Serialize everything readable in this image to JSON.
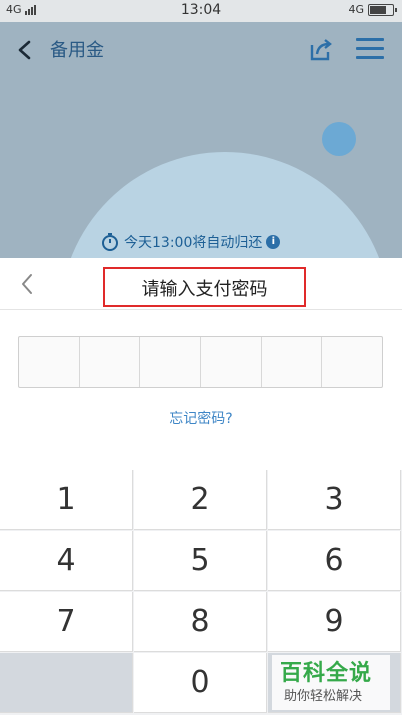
{
  "status_bar": {
    "network_left": "4G",
    "time": "13:04",
    "network_right": "4G",
    "battery_level": 0.75
  },
  "header": {
    "title": "备用金"
  },
  "notice": {
    "auto_return": "今天13:00将自动归还",
    "info": "i"
  },
  "password_sheet": {
    "title": "请输入支付密码",
    "digits": 6,
    "forgot_link": "忘记密码?"
  },
  "keypad": {
    "keys": [
      "1",
      "2",
      "3",
      "4",
      "5",
      "6",
      "7",
      "8",
      "9",
      "",
      "0",
      ""
    ]
  },
  "watermark": {
    "main": "百科全说",
    "sub": "助你轻松解决"
  },
  "colors": {
    "accent": "#2c6fa8",
    "link": "#3f86c6",
    "highlight_border": "#e02a2a",
    "brand_green": "#35a94a"
  }
}
